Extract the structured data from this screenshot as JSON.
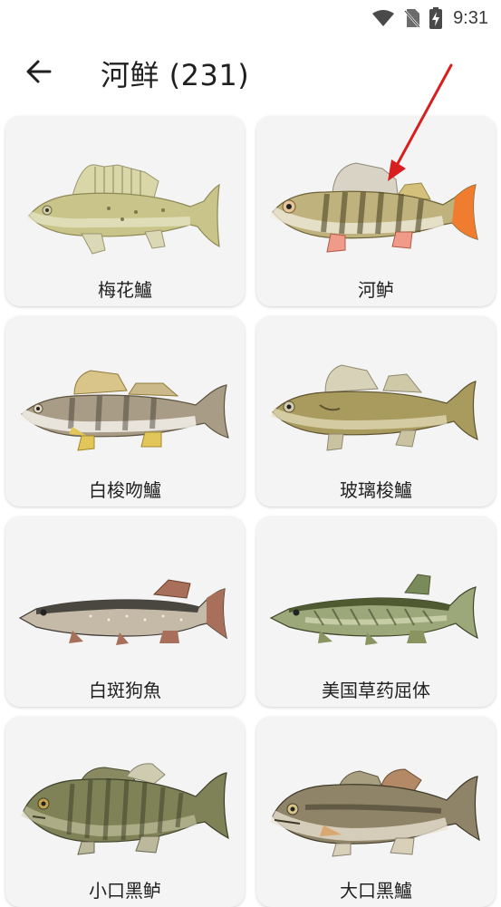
{
  "status_bar": {
    "time": "9:31",
    "icons": [
      "wifi-icon",
      "no-sim-icon",
      "battery-charging-icon"
    ]
  },
  "app_bar": {
    "back_icon": "arrow-left-icon",
    "title": "河鲜 (231)"
  },
  "fish_list": [
    {
      "name": "梅花鱸",
      "icon": "fish-ruffe"
    },
    {
      "name": "河鲈",
      "icon": "fish-perch"
    },
    {
      "name": "白梭吻鱸",
      "icon": "fish-zander"
    },
    {
      "name": "玻璃梭鱸",
      "icon": "fish-walleye"
    },
    {
      "name": "白斑狗魚",
      "icon": "fish-northern-pike"
    },
    {
      "name": "美国草药屈体",
      "icon": "fish-grass-pickerel"
    },
    {
      "name": "小口黑鲈",
      "icon": "fish-smallmouth-bass"
    },
    {
      "name": "大口黑鱸",
      "icon": "fish-largemouth-bass"
    }
  ],
  "colors": {
    "card_bg": "#f4f4f4",
    "annotation_arrow": "#d81e1e"
  }
}
